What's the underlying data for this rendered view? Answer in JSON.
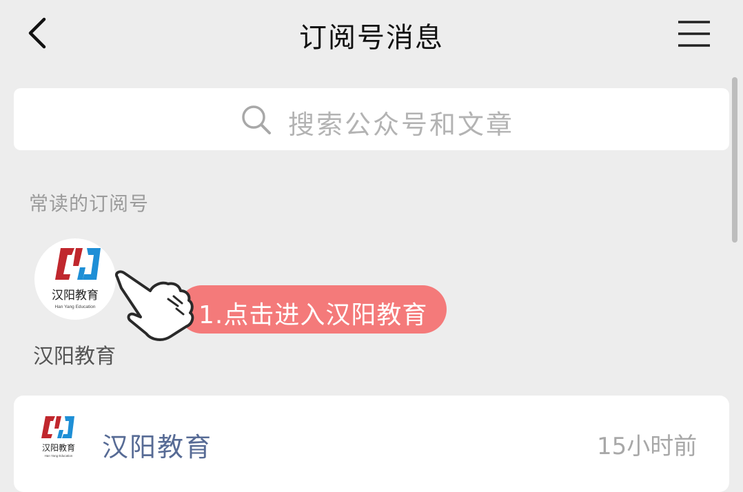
{
  "header": {
    "title": "订阅号消息",
    "back_icon": "chevron-left-icon",
    "menu_icon": "hamburger-menu-icon"
  },
  "search": {
    "placeholder": "搜索公众号和文章",
    "icon": "search-icon"
  },
  "frequent": {
    "section_label": "常读的订阅号",
    "items": [
      {
        "name": "汉阳教育",
        "logo_cn": "汉阳教育",
        "logo_en": "Han Yang Education"
      }
    ]
  },
  "tooltip": {
    "text": "1.点击进入汉阳教育",
    "icon": "pointing-hand-icon",
    "color": "#f47a7a"
  },
  "messages": [
    {
      "name": "汉阳教育",
      "time": "15小时前",
      "logo_cn": "汉阳教育",
      "logo_en": "Han Yang Education"
    }
  ],
  "colors": {
    "background": "#ededed",
    "link_blue": "#576b95",
    "logo_red": "#c0272d",
    "logo_blue": "#1e8fd6"
  }
}
